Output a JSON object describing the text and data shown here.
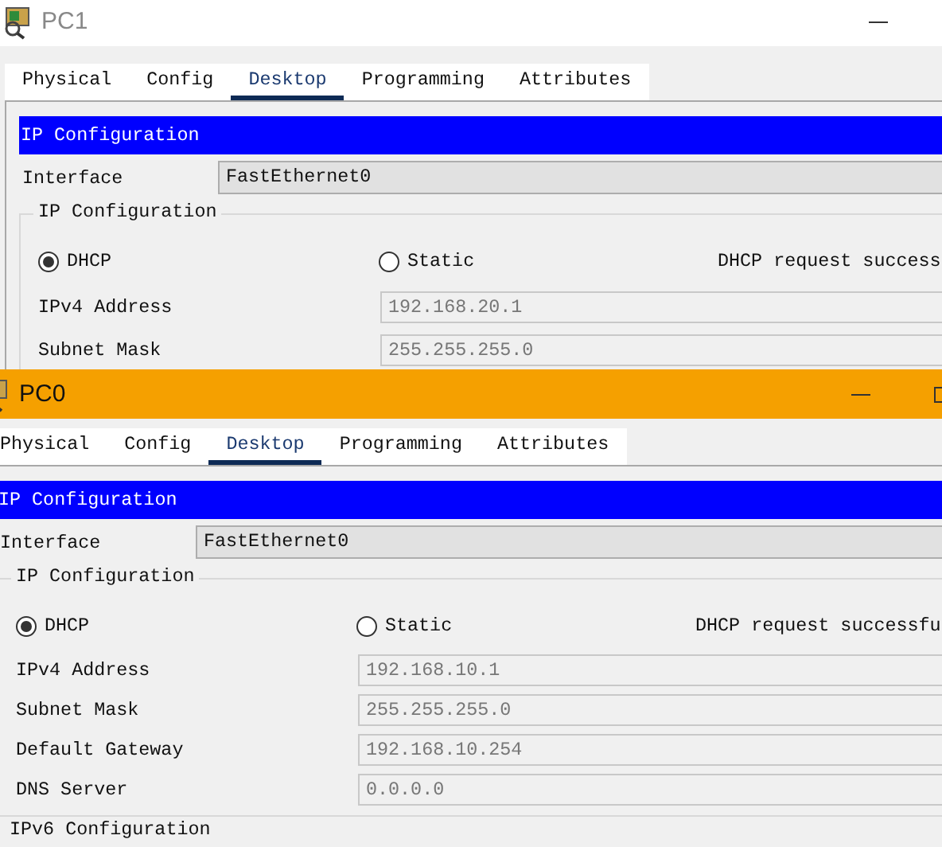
{
  "windows": [
    {
      "title": "PC1",
      "active": false,
      "tabs": [
        {
          "label": "Physical",
          "selected": false
        },
        {
          "label": "Config",
          "selected": false
        },
        {
          "label": "Desktop",
          "selected": true
        },
        {
          "label": "Programming",
          "selected": false
        },
        {
          "label": "Attributes",
          "selected": false
        }
      ],
      "section_header": "IP Configuration",
      "interface": {
        "label": "Interface",
        "value": "FastEthernet0"
      },
      "group_title": "IP Configuration",
      "radios": [
        {
          "label": "DHCP",
          "selected": true
        },
        {
          "label": "Static",
          "selected": false
        }
      ],
      "status": "DHCP request success",
      "fields": [
        {
          "label": "IPv4 Address",
          "value": "192.168.20.1",
          "disabled": true
        },
        {
          "label": "Subnet Mask",
          "value": "255.255.255.0",
          "disabled": true
        }
      ]
    },
    {
      "title": "PC0",
      "active": true,
      "tabs": [
        {
          "label": "Physical",
          "selected": false
        },
        {
          "label": "Config",
          "selected": false
        },
        {
          "label": "Desktop",
          "selected": true
        },
        {
          "label": "Programming",
          "selected": false
        },
        {
          "label": "Attributes",
          "selected": false
        }
      ],
      "section_header": "IP Configuration",
      "interface": {
        "label": "Interface",
        "value": "FastEthernet0"
      },
      "group_title": "IP Configuration",
      "radios": [
        {
          "label": "DHCP",
          "selected": true
        },
        {
          "label": "Static",
          "selected": false
        }
      ],
      "status": "DHCP request successfu",
      "fields": [
        {
          "label": "IPv4 Address",
          "value": "192.168.10.1",
          "disabled": true
        },
        {
          "label": "Subnet Mask",
          "value": "255.255.255.0",
          "disabled": true
        },
        {
          "label": "Default Gateway",
          "value": "192.168.10.254",
          "disabled": true
        },
        {
          "label": "DNS Server",
          "value": "0.0.0.0",
          "disabled": true
        }
      ],
      "next_section": "IPv6 Configuration"
    }
  ]
}
